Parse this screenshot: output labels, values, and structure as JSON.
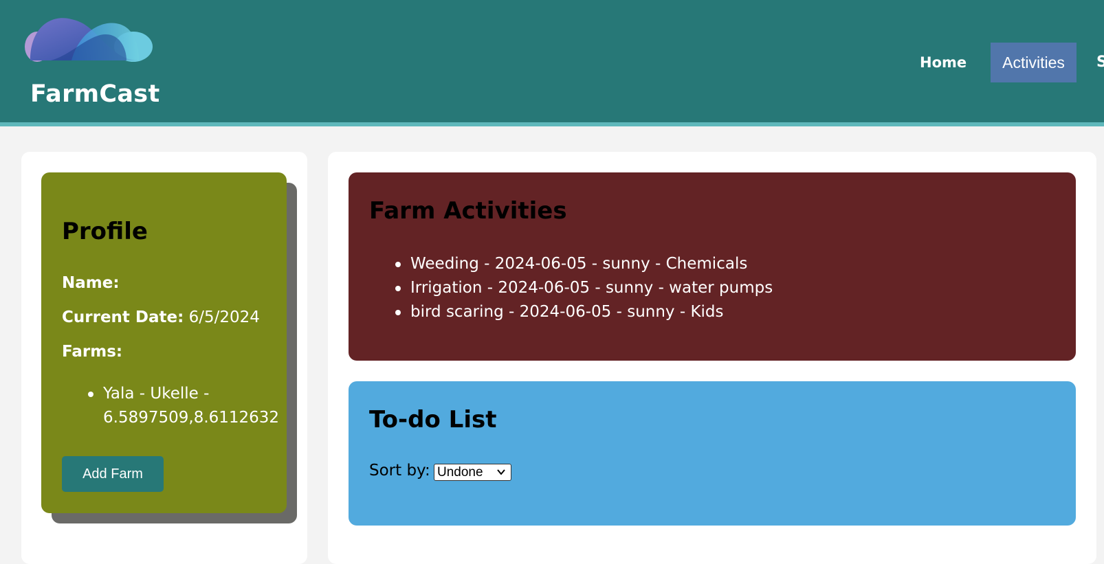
{
  "header": {
    "brand": "FarmCast",
    "logo_icon": "cloud-logo-icon",
    "nav": {
      "home": "Home",
      "activities": "Activities",
      "more": "S"
    },
    "colors": {
      "header_bg": "#277877",
      "active_nav_bg": "#5176ab"
    }
  },
  "profile": {
    "title": "Profile",
    "name_label": "Name:",
    "name_value": "",
    "date_label": "Current Date:",
    "date_value": "6/5/2024",
    "farms_label": "Farms:",
    "farms": [
      {
        "line1": "Yala - Ukelle -",
        "line2": "6.5897509,8.6112632"
      }
    ],
    "add_farm_label": "Add Farm",
    "card_color": "#7a8819"
  },
  "activities": {
    "title": "Farm Activities",
    "items": [
      "Weeding - 2024-06-05 - sunny - Chemicals",
      "Irrigation - 2024-06-05 - sunny - water pumps",
      "bird scaring - 2024-06-05 - sunny - Kids"
    ],
    "card_color": "#632325"
  },
  "todo": {
    "title": "To-do List",
    "sort_label": "Sort by:",
    "sort_selected": "Undone",
    "card_color": "#52aade"
  }
}
